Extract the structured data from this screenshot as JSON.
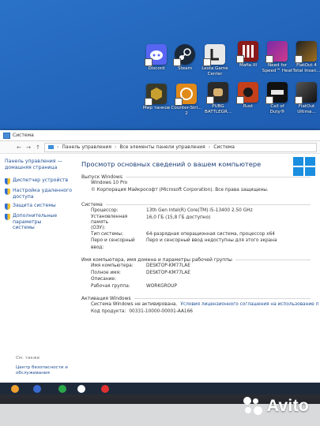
{
  "desktop": {
    "icons": [
      {
        "label": "Discord",
        "color": "#5865f2"
      },
      {
        "label": "Steam",
        "color": "#1b2838"
      },
      {
        "label": "Lesta Game\nCenter",
        "color": "#e8e8e8"
      },
      {
        "label": "Mafia III",
        "color": "#8b1a1a"
      },
      {
        "label": "Need for\nSpeed™ Heat",
        "color": "#7a2aa8"
      },
      {
        "label": "FlatOut 4\nTotal Insan...",
        "color": "#222222"
      },
      {
        "label": "Мир танков",
        "color": "#3a3a2a"
      },
      {
        "label": "Counter-Stri...\n2",
        "color": "#e08a1a"
      },
      {
        "label": "PUBG\nBATTLEGR...",
        "color": "#2a2a2a"
      },
      {
        "label": "Rust",
        "color": "#c4401a"
      },
      {
        "label": "Call of\nDuty®",
        "color": "#111111"
      },
      {
        "label": "FlatOut\nUltima...",
        "color": "#555555"
      }
    ]
  },
  "window": {
    "title": "Система",
    "breadcrumb": [
      "Панель управления",
      "Все элементы панели управления",
      "Система"
    ],
    "left_pane": {
      "home": "Панель управления —\nдомашняя страница",
      "links": [
        "Диспетчер устройств",
        "Настройка удаленного\nдоступа",
        "Защита системы",
        "Дополнительные параметры\nсистемы"
      ],
      "see_also": "См. также",
      "bottom_link": "Центр безопасности и\nобслуживания"
    },
    "main": {
      "page_title": "Просмотр основных сведений о вашем компьютере",
      "edition_header": "Выпуск Windows",
      "edition_name": "Windows 10 Pro",
      "copyright": "© Корпорация Майкрософт (Microsoft Corporation). Все права защищены.",
      "system_header": "Система",
      "system_rows": [
        {
          "k": "Процессор:",
          "v": "13th Gen Intel(R) Core(TM) i5-13400   2.50 GHz"
        },
        {
          "k": "Установленная память\n(ОЗУ):",
          "v": "16,0 ГБ (15,8 ГБ доступно)"
        },
        {
          "k": "Тип системы:",
          "v": "64-разрядная операционная система, процессор x64"
        },
        {
          "k": "Перо и сенсорный ввод:",
          "v": "Перо и сенсорный ввод недоступны для этого экрана"
        }
      ],
      "computer_header": "Имя компьютера, имя домена и параметры рабочей группы",
      "computer_rows": [
        {
          "k": "Имя компьютера:",
          "v": "DESKTOP-KM77LAE"
        },
        {
          "k": "Полное имя:",
          "v": "DESKTOP-KM77LAE"
        },
        {
          "k": "Описание:",
          "v": ""
        },
        {
          "k": "Рабочая группа:",
          "v": "WORKGROUP"
        }
      ],
      "activation_header": "Активация Windows",
      "activation_status": "Система Windows не активирована.",
      "activation_link": "Условия лицензионного соглашения на использование программного обеспечения",
      "product_code_label": "Код продукта:",
      "product_code": "00331-10000-00001-AA166"
    }
  },
  "watermark": "Avito"
}
